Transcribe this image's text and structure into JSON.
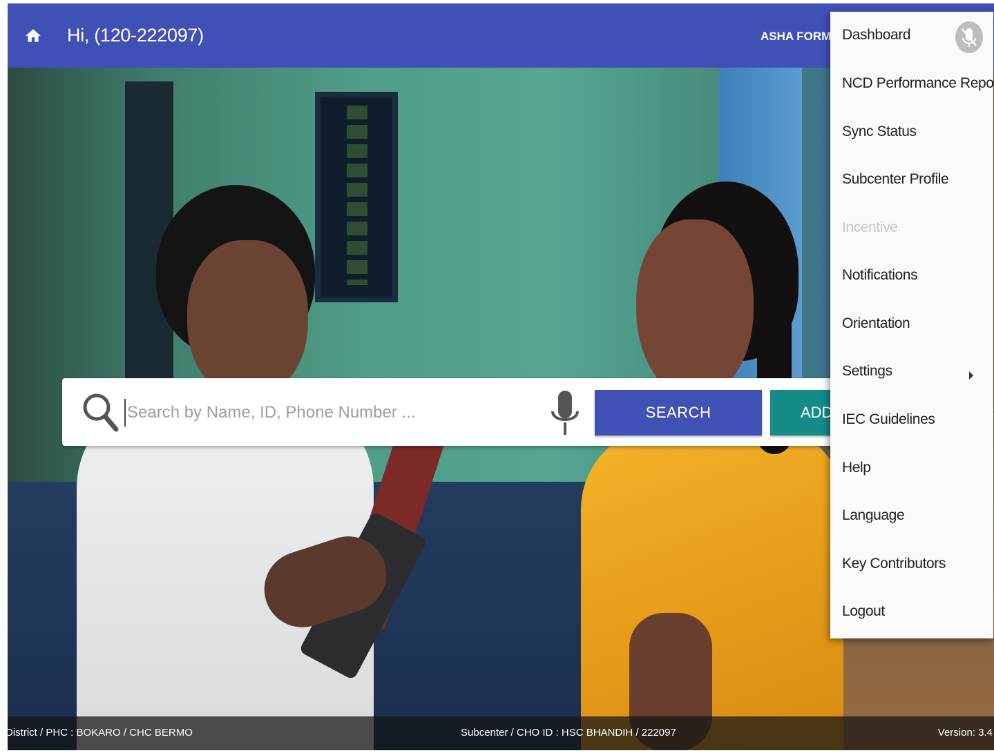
{
  "appbar": {
    "greeting": "Hi, (120-222097)",
    "right_title": "ASHA FORMAT",
    "home_icon": "home-icon"
  },
  "search": {
    "placeholder": "Search by Name, ID, Phone Number ...",
    "value": "",
    "search_label": "SEARCH",
    "add_label": "ADD",
    "icons": [
      "search-icon",
      "microphone-icon"
    ]
  },
  "menu": {
    "items": [
      {
        "label": "Dashboard",
        "enabled": true
      },
      {
        "label": "NCD Performance Report",
        "enabled": true
      },
      {
        "label": "Sync Status",
        "enabled": true
      },
      {
        "label": "Subcenter Profile",
        "enabled": true
      },
      {
        "label": "Incentive",
        "enabled": false
      },
      {
        "label": "Notifications",
        "enabled": true
      },
      {
        "label": "Orientation",
        "enabled": true
      },
      {
        "label": "Settings",
        "enabled": true,
        "has_submenu": true
      },
      {
        "label": "IEC Guidelines",
        "enabled": true
      },
      {
        "label": "Help",
        "enabled": true
      },
      {
        "label": "Language",
        "enabled": true
      },
      {
        "label": "Key Contributors",
        "enabled": true
      },
      {
        "label": "Logout",
        "enabled": true
      }
    ],
    "mic_icon": "microphone-off-icon"
  },
  "footer": {
    "left": "District / PHC : BOKARO / CHC BERMO",
    "middle": "Subcenter / CHO ID : HSC BHANDIH / 222097",
    "right": "Version: 3.4"
  },
  "colors": {
    "primary": "#3f51b5",
    "add_button": "#158b87",
    "disabled_text": "#c7c7c7"
  }
}
